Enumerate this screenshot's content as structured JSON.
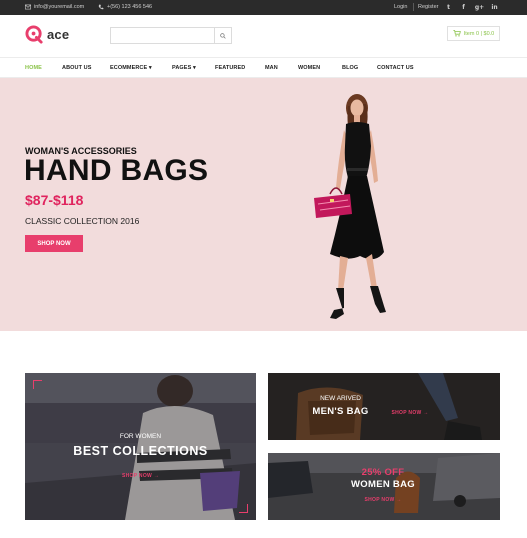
{
  "topbar": {
    "email": "info@youremail.com",
    "phone": "+(56) 123 456 546",
    "login": "Login",
    "register": "Register",
    "social": [
      "t",
      "f",
      "g+",
      "in"
    ]
  },
  "header": {
    "logo_text": "ace",
    "search_placeholder": "",
    "cart_label": "Item 0 | $0.0"
  },
  "nav": {
    "items": [
      "HOME",
      "ABOUT US",
      "ECOMMERCE ▾",
      "PAGES ▾",
      "FEATURED",
      "MAN",
      "WOMEN",
      "BLOG",
      "CONTACT US"
    ],
    "active_index": 0
  },
  "hero": {
    "eyebrow": "WOMAN'S ACCESSORIES",
    "title": "HAND BAGS",
    "price": "$87-$118",
    "subtitle": "CLASSIC COLLECTION 2016",
    "button": "SHOP NOW"
  },
  "banners": {
    "collections": {
      "small": "FOR WOMEN",
      "big": "BEST COLLECTIONS",
      "link": "SHOP NOW →"
    },
    "mens": {
      "small": "NEW ARIVED",
      "big": "MEN'S BAG",
      "link": "SHOP NOW →"
    },
    "women": {
      "big_line1": "25% OFF",
      "big_line2": "WOMEN BAG",
      "link": "SHOP NOW →"
    }
  },
  "colors": {
    "accent": "#e83e6c",
    "nav_active": "#8bc34a",
    "hero_bg": "#f2dcdc",
    "topbar_bg": "#2b2b2b"
  }
}
